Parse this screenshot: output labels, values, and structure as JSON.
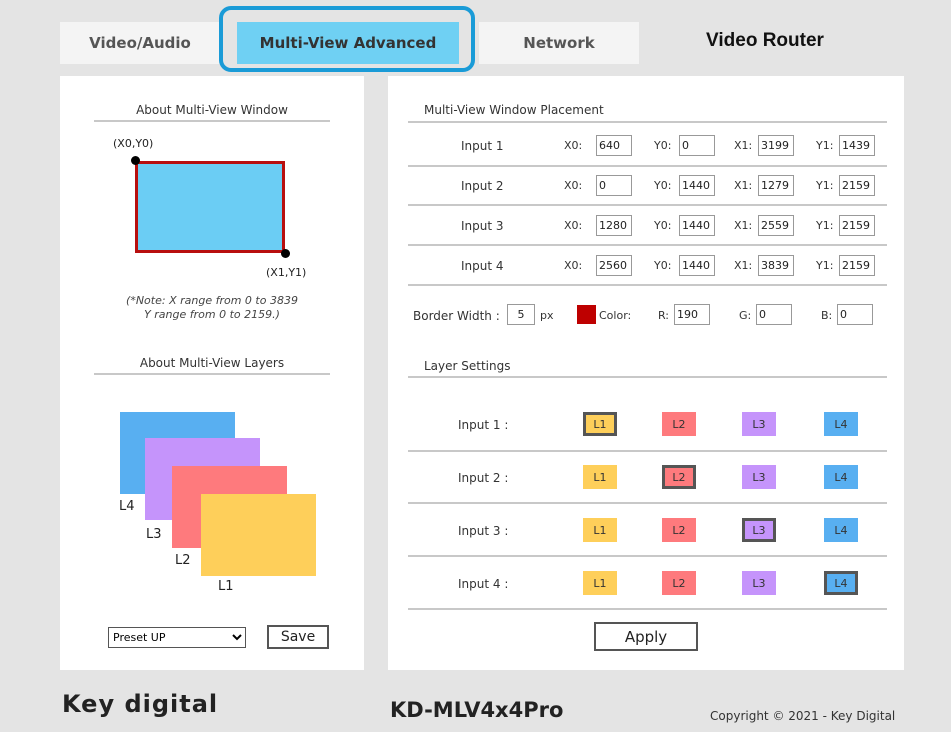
{
  "tabs": [
    {
      "label": "Video/Audio"
    },
    {
      "label": "Multi-View Advanced"
    },
    {
      "label": "Network"
    }
  ],
  "header": {
    "title": "Video Router"
  },
  "left": {
    "window_section_title": "About Multi-View Window",
    "top_left_coord": "(X0,Y0)",
    "bottom_right_coord": "(X1,Y1)",
    "note_line1": "(*Note: X range from 0 to 3839",
    "note_line2": "Y range from 0 to 2159.)",
    "layers_section_title": "About Multi-View Layers",
    "layer_labels": [
      "L4",
      "L3",
      "L2",
      "L1"
    ],
    "preset_selected": "Preset UP",
    "save_label": "Save"
  },
  "placement": {
    "title": "Multi-View Window Placement",
    "field_labels": [
      "X0:",
      "Y0:",
      "X1:",
      "Y1:"
    ],
    "rows": [
      {
        "label": "Input 1",
        "x0": "640",
        "y0": "0",
        "x1": "3199",
        "y1": "1439"
      },
      {
        "label": "Input 2",
        "x0": "0",
        "y0": "1440",
        "x1": "1279",
        "y1": "2159"
      },
      {
        "label": "Input 3",
        "x0": "1280",
        "y0": "1440",
        "x1": "2559",
        "y1": "2159"
      },
      {
        "label": "Input 4",
        "x0": "2560",
        "y0": "1440",
        "x1": "3839",
        "y1": "2159"
      }
    ],
    "border_width_label": "Border Width :",
    "border_width": "5",
    "border_unit": "px",
    "color_label": "Color:",
    "r_label": "R:",
    "r": "190",
    "g_label": "G:",
    "g": "0",
    "b_label": "B:",
    "b": "0",
    "border_color": "#be0000"
  },
  "layers": {
    "title": "Layer Settings",
    "layer_names": [
      "L1",
      "L2",
      "L3",
      "L4"
    ],
    "rows": [
      {
        "label": "Input 1 :",
        "selected": "L1"
      },
      {
        "label": "Input 2 :",
        "selected": "L2"
      },
      {
        "label": "Input 3 :",
        "selected": "L3"
      },
      {
        "label": "Input 4 :",
        "selected": "L4"
      }
    ],
    "apply_label": "Apply"
  },
  "colors": {
    "l1": "#fecf5a",
    "l2": "#fe7a7d",
    "l3": "#c594fb",
    "l4": "#58aff1",
    "tab_active": "#6fd0f3",
    "tab_highlight": "#1a9bd7",
    "window_fill": "#6bcdf4",
    "window_border": "#b80f0f"
  },
  "footer": {
    "brand": "Key digital",
    "model": "KD-MLV4x4Pro",
    "copyright": "Copyright © 2021 - Key Digital"
  }
}
